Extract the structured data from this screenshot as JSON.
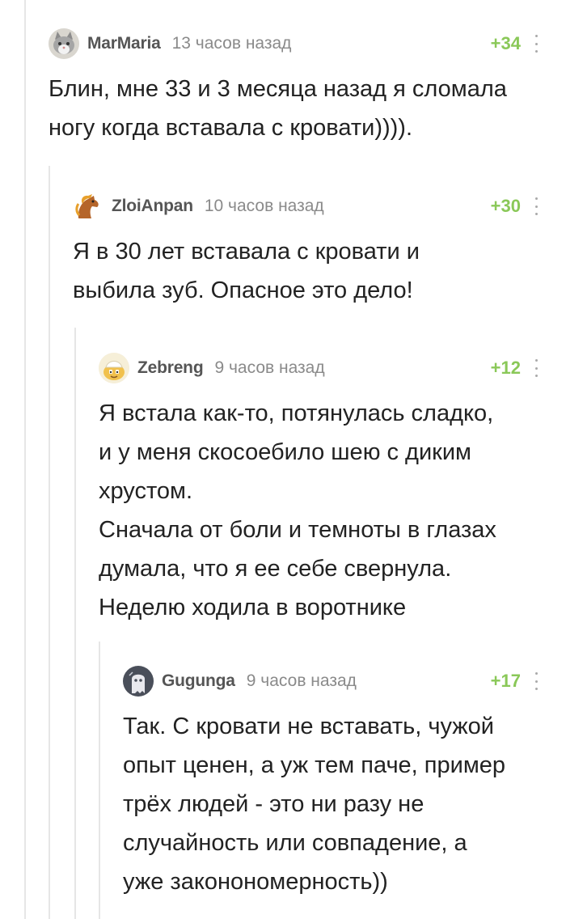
{
  "comments": [
    {
      "username": "MarMaria",
      "time": "13 часов назад",
      "rating": "+34",
      "avatar_icon": "cat-avatar-icon",
      "text": "Блин, мне 33 и 3 месяца назад я сломала\nногу когда вставала с кровати))))."
    },
    {
      "username": "ZloiAnpan",
      "time": "10 часов назад",
      "rating": "+30",
      "avatar_icon": "horse-avatar-icon",
      "text": "Я в 30 лет вставала с кровати и\nвыбила зуб. Опасное это дело!"
    },
    {
      "username": "Zebreng",
      "time": "9 часов назад",
      "rating": "+12",
      "avatar_icon": "cartoon-avatar-icon",
      "text": "Я встала как-то, потянулась сладко,\nи у меня скосоебило шею с диким\nхрустом.\nСначала от боли и темноты в глазах\nдумала, что я ее себе свернула.\nНеделю ходила в воротнике"
    },
    {
      "username": "Gugunga",
      "time": "9 часов назад",
      "rating": "+17",
      "avatar_icon": "ghost-avatar-icon",
      "text": "Так. С кровати не вставать, чужой\nопыт ценен, а уж тем паче, пример\nтрёх людей - это ни разу не\nслучайность или совпадение, а\nуже законономерность))"
    }
  ],
  "colors": {
    "rating_positive": "#8ac858",
    "username": "#555555",
    "timestamp": "#8a8a8a",
    "branch_line": "#e6e6e6"
  }
}
